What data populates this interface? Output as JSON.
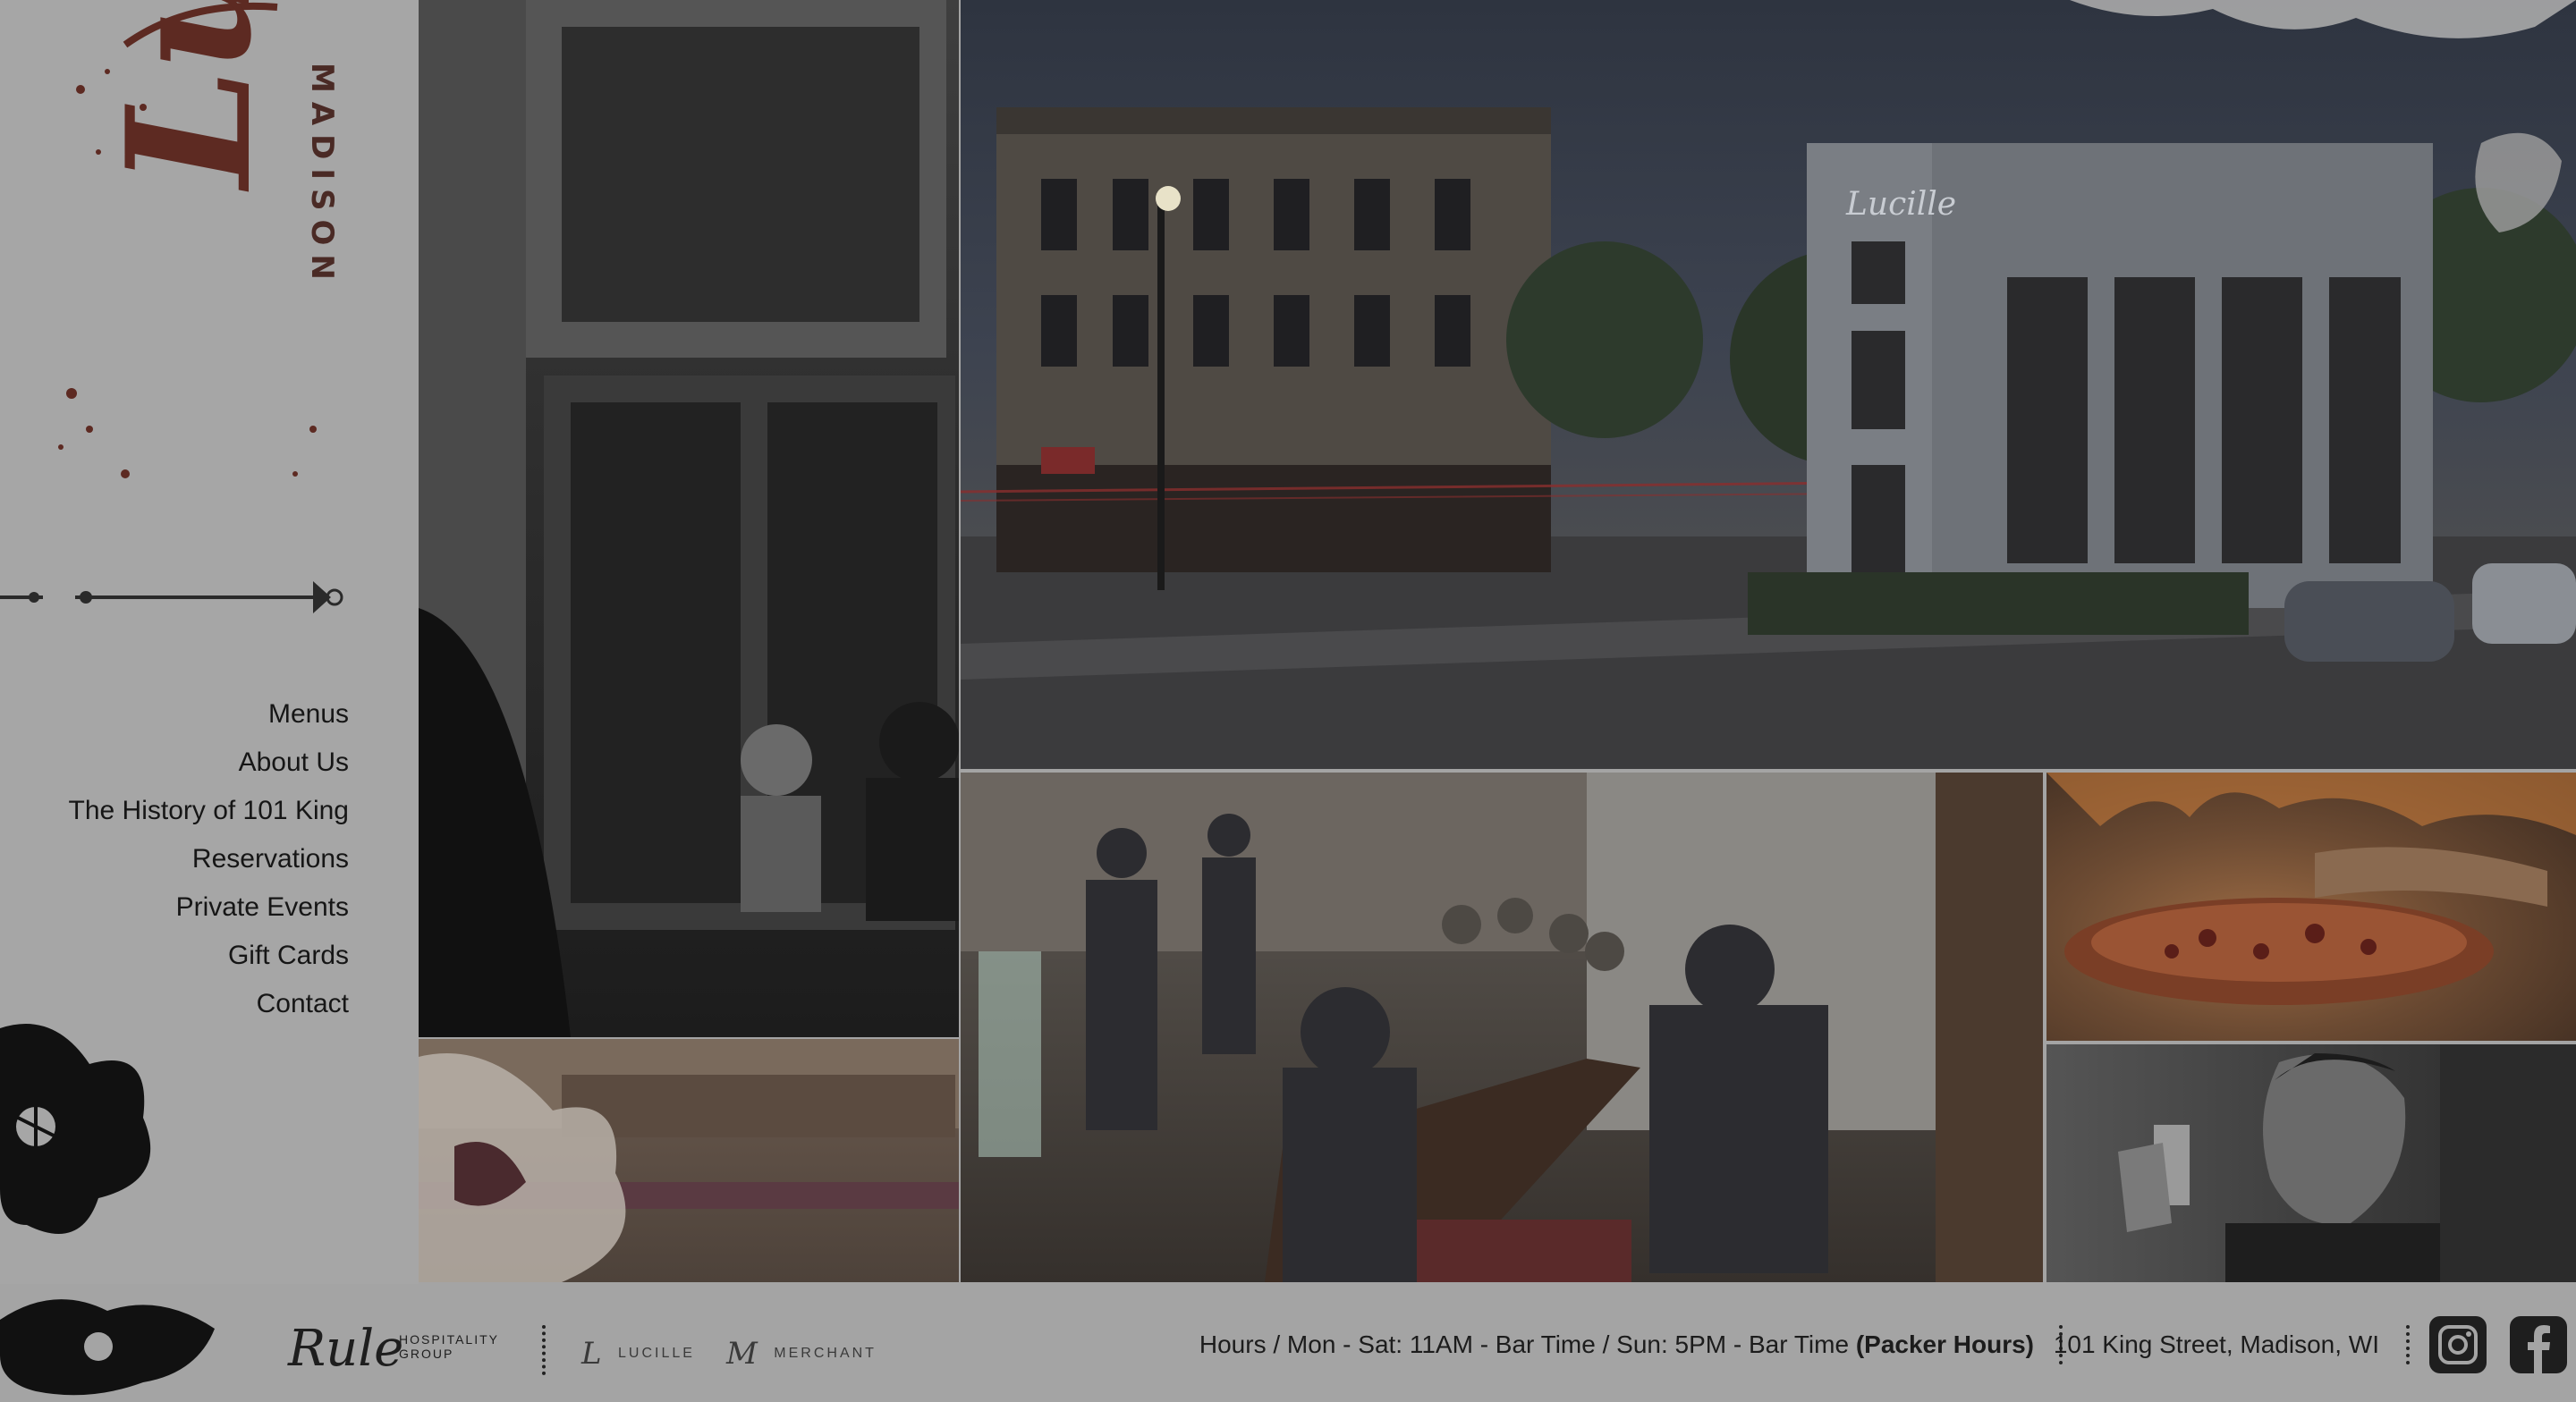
{
  "brand": {
    "script_name": "Lucille",
    "city": "MADISON"
  },
  "nav": {
    "items": [
      {
        "label": "Menus"
      },
      {
        "label": "About Us"
      },
      {
        "label": "The History of 101 King"
      },
      {
        "label": "Reservations"
      },
      {
        "label": "Private Events"
      },
      {
        "label": "Gift Cards"
      },
      {
        "label": "Contact"
      }
    ]
  },
  "photos": {
    "street_sign": "Lucille"
  },
  "footer": {
    "group_logo_word": "Rule",
    "group_logo_line1": "HOSPITALITY",
    "group_logo_line2": "GROUP",
    "brand_lucille": "LUCILLE",
    "brand_merchant": "MERCHANT",
    "hours_text": "Hours / Mon - Sat: 11AM - Bar Time / Sun: 5PM - Bar Time",
    "hours_packer": "(Packer Hours)",
    "address": "101 King Street, Madison, WI",
    "icons": [
      "instagram-icon",
      "facebook-icon"
    ]
  },
  "colors": {
    "brand_red": "#5d2a22",
    "overlay_gray": "#a4a4a4",
    "text_dark": "#161616"
  }
}
